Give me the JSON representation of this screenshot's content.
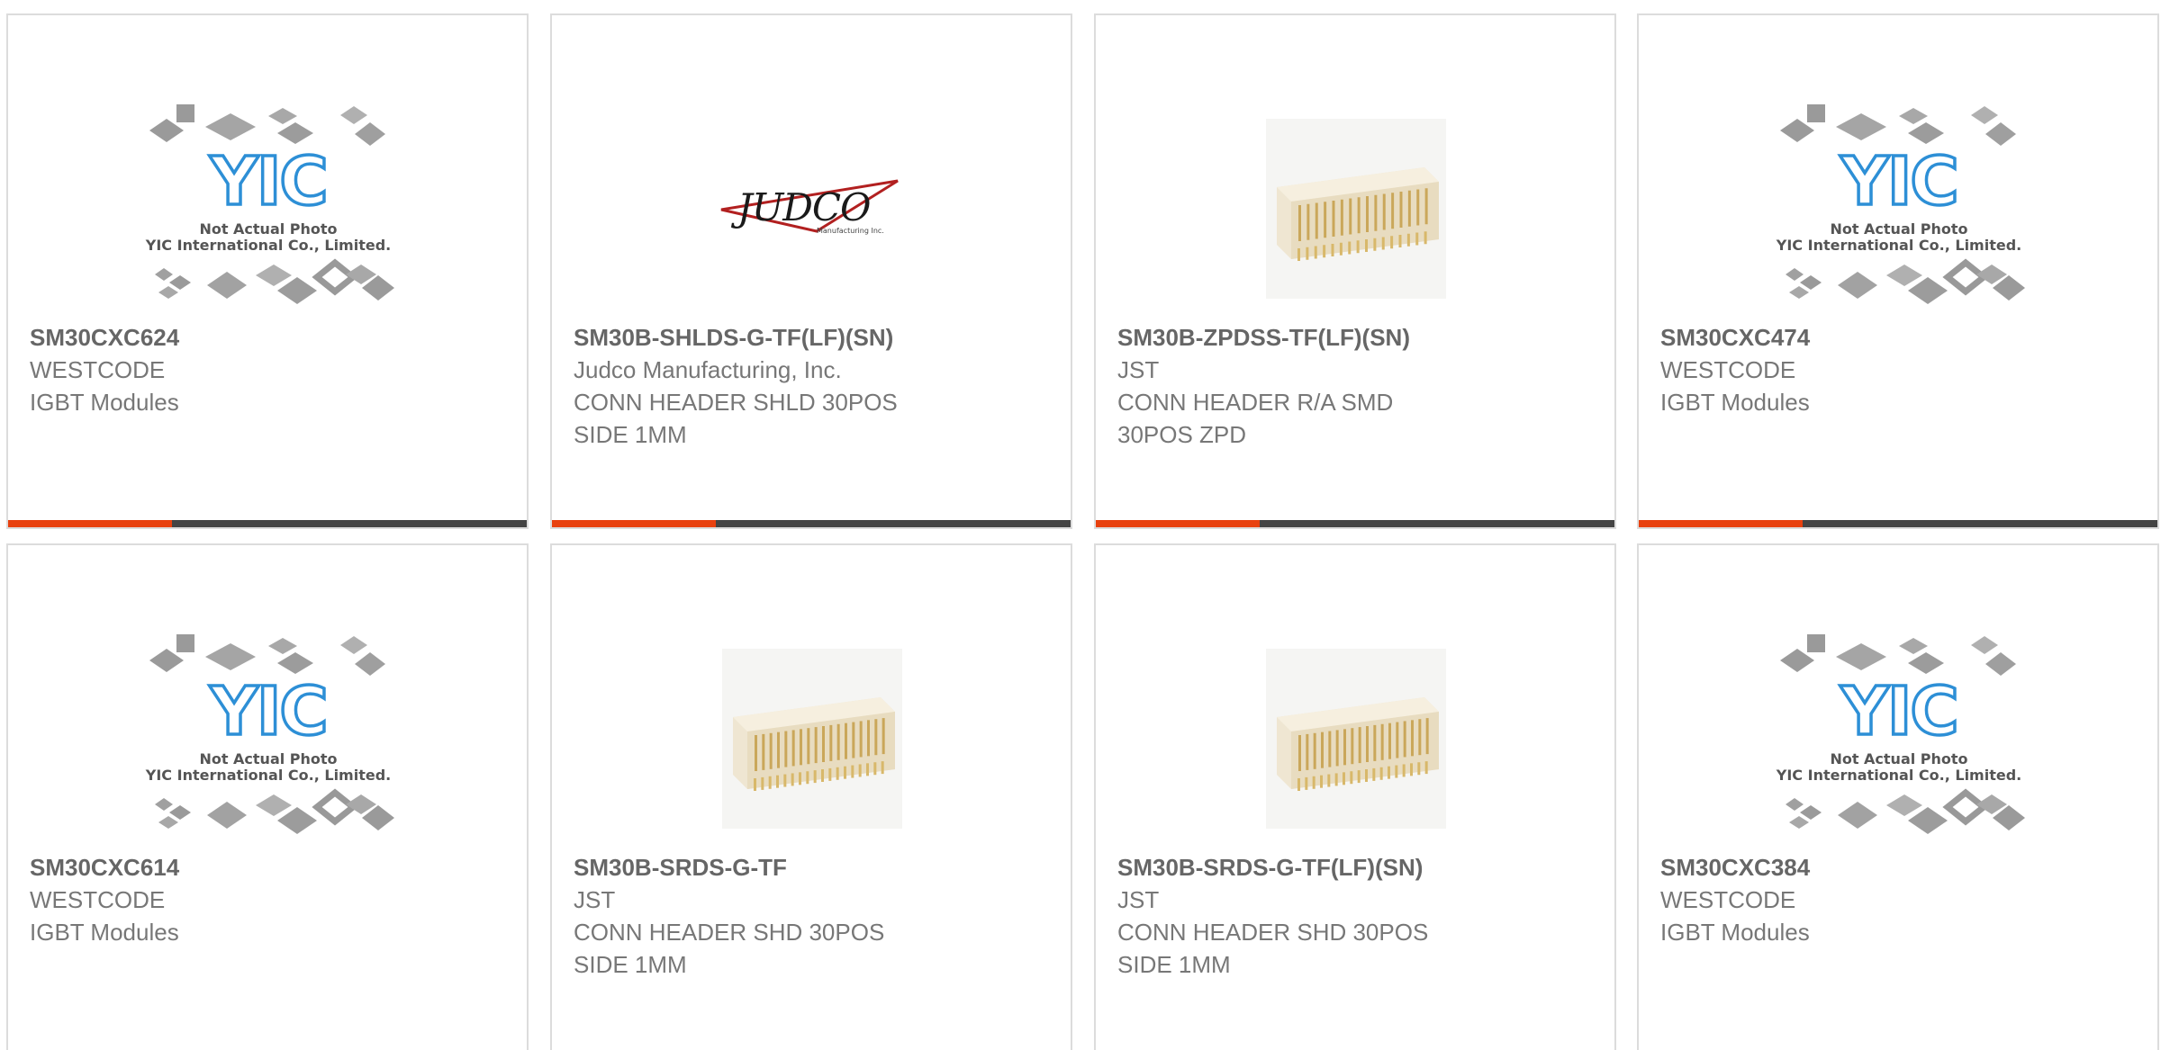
{
  "brand": {
    "accent_color": "#e8410f",
    "bar_color": "#444444"
  },
  "placeholder": {
    "logo_text": "YIC",
    "line1": "Not Actual Photo",
    "line2": "YIC International Co., Limited."
  },
  "judco_logo": {
    "name": "JUDCO",
    "tagline": "Manufacturing Inc."
  },
  "products": [
    {
      "part_number": "SM30CXC624",
      "manufacturer": "WESTCODE",
      "description": "IGBT Modules",
      "image": "yic-placeholder"
    },
    {
      "part_number": "SM30B-SHLDS-G-TF(LF)(SN)",
      "manufacturer": "Judco Manufacturing, Inc.",
      "description": "CONN HEADER SHLD 30POS\nSIDE 1MM",
      "image": "judco-logo"
    },
    {
      "part_number": "SM30B-ZPDSS-TF(LF)(SN)",
      "manufacturer": "JST",
      "description": "CONN HEADER R/A SMD\n30POS ZPD",
      "image": "connector-photo"
    },
    {
      "part_number": "SM30CXC474",
      "manufacturer": "WESTCODE",
      "description": "IGBT Modules",
      "image": "yic-placeholder"
    },
    {
      "part_number": "SM30CXC614",
      "manufacturer": "WESTCODE",
      "description": "IGBT Modules",
      "image": "yic-placeholder"
    },
    {
      "part_number": "SM30B-SRDS-G-TF",
      "manufacturer": "JST",
      "description": "CONN HEADER SHD 30POS\nSIDE 1MM",
      "image": "connector-photo"
    },
    {
      "part_number": "SM30B-SRDS-G-TF(LF)(SN)",
      "manufacturer": "JST",
      "description": "CONN HEADER SHD 30POS\nSIDE 1MM",
      "image": "connector-photo"
    },
    {
      "part_number": "SM30CXC384",
      "manufacturer": "WESTCODE",
      "description": "IGBT Modules",
      "image": "yic-placeholder"
    }
  ]
}
